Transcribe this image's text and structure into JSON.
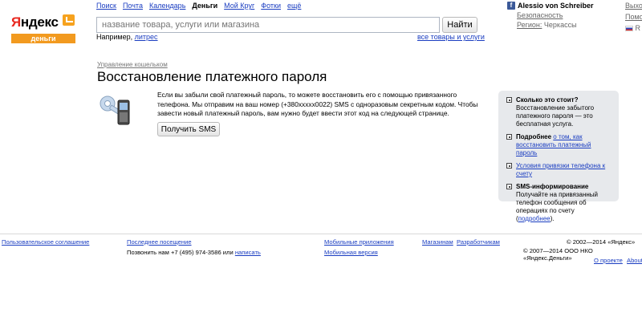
{
  "logo": {
    "word_red": "Я",
    "word_rest": "ндекс",
    "sub": "деньги"
  },
  "topnav": [
    {
      "label": "Поиск",
      "active": false
    },
    {
      "label": "Почта",
      "active": false
    },
    {
      "label": "Календарь",
      "active": false
    },
    {
      "label": "Деньги",
      "active": true
    },
    {
      "label": "Мой Круг",
      "active": false
    },
    {
      "label": "Фотки",
      "active": false
    },
    {
      "label": "ещё",
      "active": false
    }
  ],
  "search": {
    "placeholder": "название товара, услуги или магазина",
    "button": "Найти",
    "example_label": "Например,",
    "example_link": "литрес",
    "all_goods": "все товары и услуги"
  },
  "user": {
    "name": "Alessio von Schreiber",
    "security": "Безопасность",
    "region_label": "Регион:",
    "region_value": "Черкассы"
  },
  "right_col": {
    "exit": "Выход",
    "help": "Помощ",
    "lang": "R"
  },
  "page": {
    "breadcrumb": "Управление кошельком",
    "title": "Восстановление платежного пароля",
    "text": "Если вы забыли свой платежный пароль, то можете восстановить его с помощью привязанного телефона. Мы отправим на ваш номер (+380xxxxx0022) SMS с одноразовым секретным кодом. Чтобы завести новый платежный пароль, вам нужно будет ввести этот код на следующей странице.",
    "sms_button": "Получить SMS"
  },
  "info": {
    "cost_title": "Сколько это стоит?",
    "cost_text": "Восстановление забытого платежного пароля — это бесплатная услуга.",
    "more_label": "Подробнее",
    "more_link": "о том, как восстановить платежный пароль",
    "binding_link": "Условия привязки телефона к счету",
    "sms_title": "SMS-информирование",
    "sms_text": "Получайте на привязанный телефон сообщения об операциях по счету (",
    "sms_more": "подробнее",
    "sms_end": ")."
  },
  "footer": {
    "agreement": "Пользовательское соглашение",
    "last_visit": "Последнее посещение",
    "call_text": "Позвонить нам +7 (495) 974-3586 или",
    "write": "написать",
    "mobile_apps": "Мобильные приложения",
    "mobile_version": "Мобильная версия",
    "shops": "Магазинам",
    "developers": "Разработчикам",
    "copyright1": "© 2002—2014 «Яндекс»",
    "copyright2": "© 2007—2014 ООО НКО «Яндекс.Деньги»",
    "about_project": "О проекте",
    "about": "About"
  }
}
